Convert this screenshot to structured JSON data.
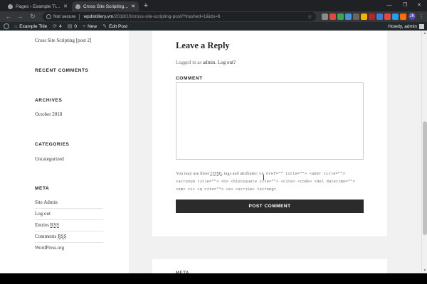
{
  "browser": {
    "tabs": [
      {
        "title": "Pages ‹ Example Title — WordPress"
      },
      {
        "title": "Cross Site Scripting [post 2] | Example Title"
      }
    ],
    "new_tab_symbol": "+",
    "tab_close_symbol": "✕",
    "window_controls": {
      "minimize": "—",
      "maximize": "❐",
      "close": "✕"
    },
    "nav": {
      "back": "←",
      "forward": "→",
      "reload": "↻"
    },
    "security_label": "Not secure",
    "url_domain": "wpdistillery.vm",
    "url_path": "/2018/10/cross-site-scripting-post/?trashed=1&ids=8",
    "bookmark_icon": "star-icon",
    "extensions": [
      {
        "name": "ext-icon-1",
        "color": "#8a8a8a"
      },
      {
        "name": "ext-icon-2",
        "color": "#e8453c"
      },
      {
        "name": "ext-icon-3",
        "color": "#34a853"
      },
      {
        "name": "ext-icon-4",
        "color": "#4a90d9"
      },
      {
        "name": "ext-icon-5",
        "color": "#666666"
      },
      {
        "name": "ext-icon-6",
        "color": "#f4b400"
      },
      {
        "name": "ext-icon-7",
        "color": "#b5261e"
      },
      {
        "name": "ext-icon-8",
        "color": "#3b7dd8"
      },
      {
        "name": "ext-icon-9",
        "color": "#e8453c"
      },
      {
        "name": "ext-icon-10",
        "color": "#1da1f2"
      },
      {
        "name": "ext-icon-11",
        "color": "#ff6d00"
      }
    ],
    "profile_initial": "JK"
  },
  "adminbar": {
    "site_title": "Example Title",
    "updates_count": "4",
    "comments_count": "0",
    "new_label": "New",
    "edit_label": "Edit Post",
    "howdy": "Howdy, admin"
  },
  "sidebar": {
    "top_link": "Cross Site Scripting [post 2]",
    "recent_comments_heading": "RECENT COMMENTS",
    "archives_heading": "ARCHIVES",
    "archive_item": "October 2018",
    "categories_heading": "CATEGORIES",
    "category_item": "Uncategorized",
    "meta_heading": "META",
    "meta_links": {
      "site_admin": "Site Admin",
      "log_out": "Log out",
      "entries_prefix": "Entries ",
      "entries_abbr": "RSS",
      "comments_prefix": "Comments ",
      "comments_abbr": "RSS",
      "wordpress_org": "WordPress.org"
    }
  },
  "reply": {
    "title": "Leave a Reply",
    "logged_prefix": "Logged in as ",
    "logged_user": "admin",
    "logged_sep": ". ",
    "logout_link": "Log out?",
    "comment_label": "COMMENT",
    "comment_value": "",
    "allowed_prefix": "You may use these ",
    "allowed_abbr": "HTML",
    "allowed_middle": " tags and attributes: ",
    "allowed_tags": "<a href=\"\" title=\"\"> <abbr title=\"\"> <acronym title=\"\"> <b> <blockquote cite=\"\"> <cite> <code> <del datetime=\"\"> <em> <i> <q cite=\"\"> <s> <strike> <strong>",
    "submit_label": "POST COMMENT"
  },
  "next_widget_heading": "META",
  "colors": {
    "admin_bar": "#23282d",
    "button": "#2b2b2b",
    "chrome_dark": "#202124",
    "grammarly": "#15c39a"
  }
}
